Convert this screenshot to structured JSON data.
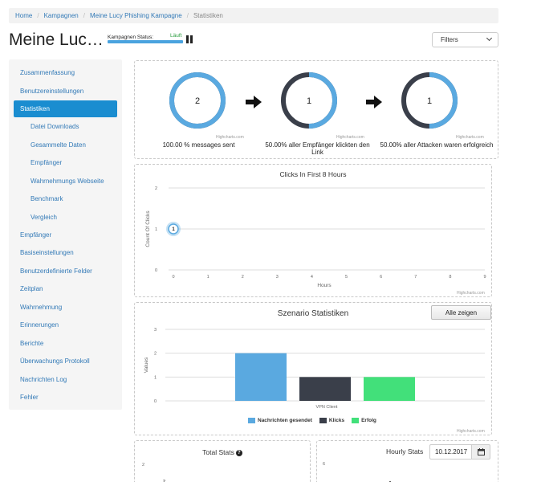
{
  "breadcrumb": {
    "items": [
      "Home",
      "Kampagnen",
      "Meine Lucy Phishing Kampagne"
    ],
    "current": "Statistiken"
  },
  "header": {
    "title": "Meine Luc…",
    "status_label": "Kampagnen Status:",
    "status_value": "Läuft",
    "filters_label": "Filters"
  },
  "sidebar": {
    "items": [
      {
        "label": "Zusammenfassung",
        "active": false
      },
      {
        "label": "Benutzereinstellungen",
        "active": false
      },
      {
        "label": "Statistiken",
        "active": true
      },
      {
        "label": "Datei Downloads",
        "active": false
      },
      {
        "label": "Gesammelte Daten",
        "active": false
      },
      {
        "label": "Empfänger",
        "active": false
      },
      {
        "label": "Wahrnehmungs Webseite",
        "active": false
      },
      {
        "label": "Benchmark",
        "active": false
      },
      {
        "label": "Vergleich",
        "active": false
      },
      {
        "label": "Empfänger",
        "active": false
      },
      {
        "label": "Basiseinstellungen",
        "active": false
      },
      {
        "label": "Benutzerdefinierte Felder",
        "active": false
      },
      {
        "label": "Zeitplan",
        "active": false
      },
      {
        "label": "Wahrnehmung",
        "active": false
      },
      {
        "label": "Erinnerungen",
        "active": false
      },
      {
        "label": "Berichte",
        "active": false
      },
      {
        "label": "Überwachungs Protokoll",
        "active": false
      },
      {
        "label": "Nachrichten Log",
        "active": false
      },
      {
        "label": "Fehler",
        "active": false
      }
    ]
  },
  "funnel": {
    "credit": "Highcharts.com",
    "donuts": [
      {
        "value": "2",
        "caption": "100.00 % messages sent",
        "fraction": 1.0,
        "color": "#5aa9e0"
      },
      {
        "value": "1",
        "caption": "50.00% aller Empfänger klickten den Link",
        "fraction": 0.5,
        "color": "#5aa9e0"
      },
      {
        "value": "1",
        "caption": "50.00% aller Attacken waren erfolgreich",
        "fraction": 0.5,
        "color": "#5aa9e0"
      }
    ],
    "remainder_color": "#3a3f4a"
  },
  "clicks_chart": {
    "title": "Clicks In First 8 Hours",
    "xlabel": "Hours",
    "ylabel": "Count Of Clicks",
    "credit": "Highcharts.com"
  },
  "scenario_chart": {
    "title": "Szenario Statistiken",
    "show_all_label": "Alle zeigen",
    "ylabel": "Values",
    "credit": "Highcharts.com"
  },
  "total_stats": {
    "title": "Total Stats",
    "help": "?",
    "tick_top": "2",
    "tick_partial": "2"
  },
  "hourly_stats": {
    "title": "Hourly Stats",
    "date": "10.12.2017",
    "tick_top": "6"
  },
  "chart_data": [
    {
      "type": "scatter",
      "title": "Clicks In First 8 Hours",
      "xlabel": "Hours",
      "ylabel": "Count Of Clicks",
      "xlim": [
        0,
        9
      ],
      "ylim": [
        0,
        2
      ],
      "x_ticks": [
        "0",
        "1",
        "2",
        "3",
        "4",
        "5",
        "6",
        "7",
        "8",
        "9"
      ],
      "y_ticks": [
        "0",
        "1",
        "2"
      ],
      "points": [
        {
          "x": 0,
          "y": 1,
          "label": "1"
        }
      ],
      "grid": true,
      "point_color": "#5aa9e0"
    },
    {
      "type": "bar",
      "title": "Szenario Statistiken",
      "xlabel": "",
      "ylabel": "Values",
      "categories": [
        "VPN Client"
      ],
      "ylim": [
        0,
        3
      ],
      "y_ticks": [
        "0",
        "1",
        "2",
        "3"
      ],
      "series": [
        {
          "name": "Nachrichten gesendet",
          "values": [
            2
          ],
          "color": "#5aa9e0"
        },
        {
          "name": "Klicks",
          "values": [
            1
          ],
          "color": "#3a3f4a"
        },
        {
          "name": "Erfolg",
          "values": [
            1
          ],
          "color": "#42e07a"
        }
      ],
      "legend": "bottom",
      "grid": true
    }
  ]
}
